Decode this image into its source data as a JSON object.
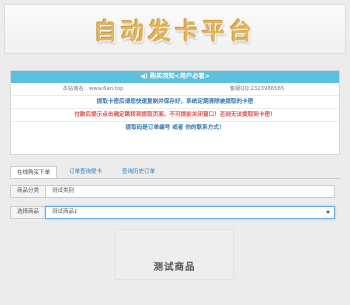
{
  "header": {
    "title": "自动发卡平台"
  },
  "notice_panel": {
    "heading": "◀) 购买须知<用户必看>",
    "site_url": "本站域名：www.6an.top",
    "support_qq": "客服QQ:2323986565",
    "lines": [
      "提取卡密后请您快速复制并保存好，系统定期清除被提取的卡密",
      "付款后提示点击确定跳转到提取页面，不可提前关闭窗口！否则无法提取到卡密！",
      "提取码是订单编号 或者 你的联系方式！"
    ]
  },
  "tabs": [
    "在线购买下单",
    "订单查询提卡",
    "查询历史订单"
  ],
  "form": {
    "category_label": "商品分类",
    "category_value": "测试类别",
    "product_label": "选择商品",
    "product_value": "测试商品1"
  },
  "product_image_text": "测试商品",
  "colors": {
    "banner_title": "#e3b45e",
    "panel_head": "#5bc0de",
    "link": "#3278b3",
    "alert": "#d9534f"
  }
}
